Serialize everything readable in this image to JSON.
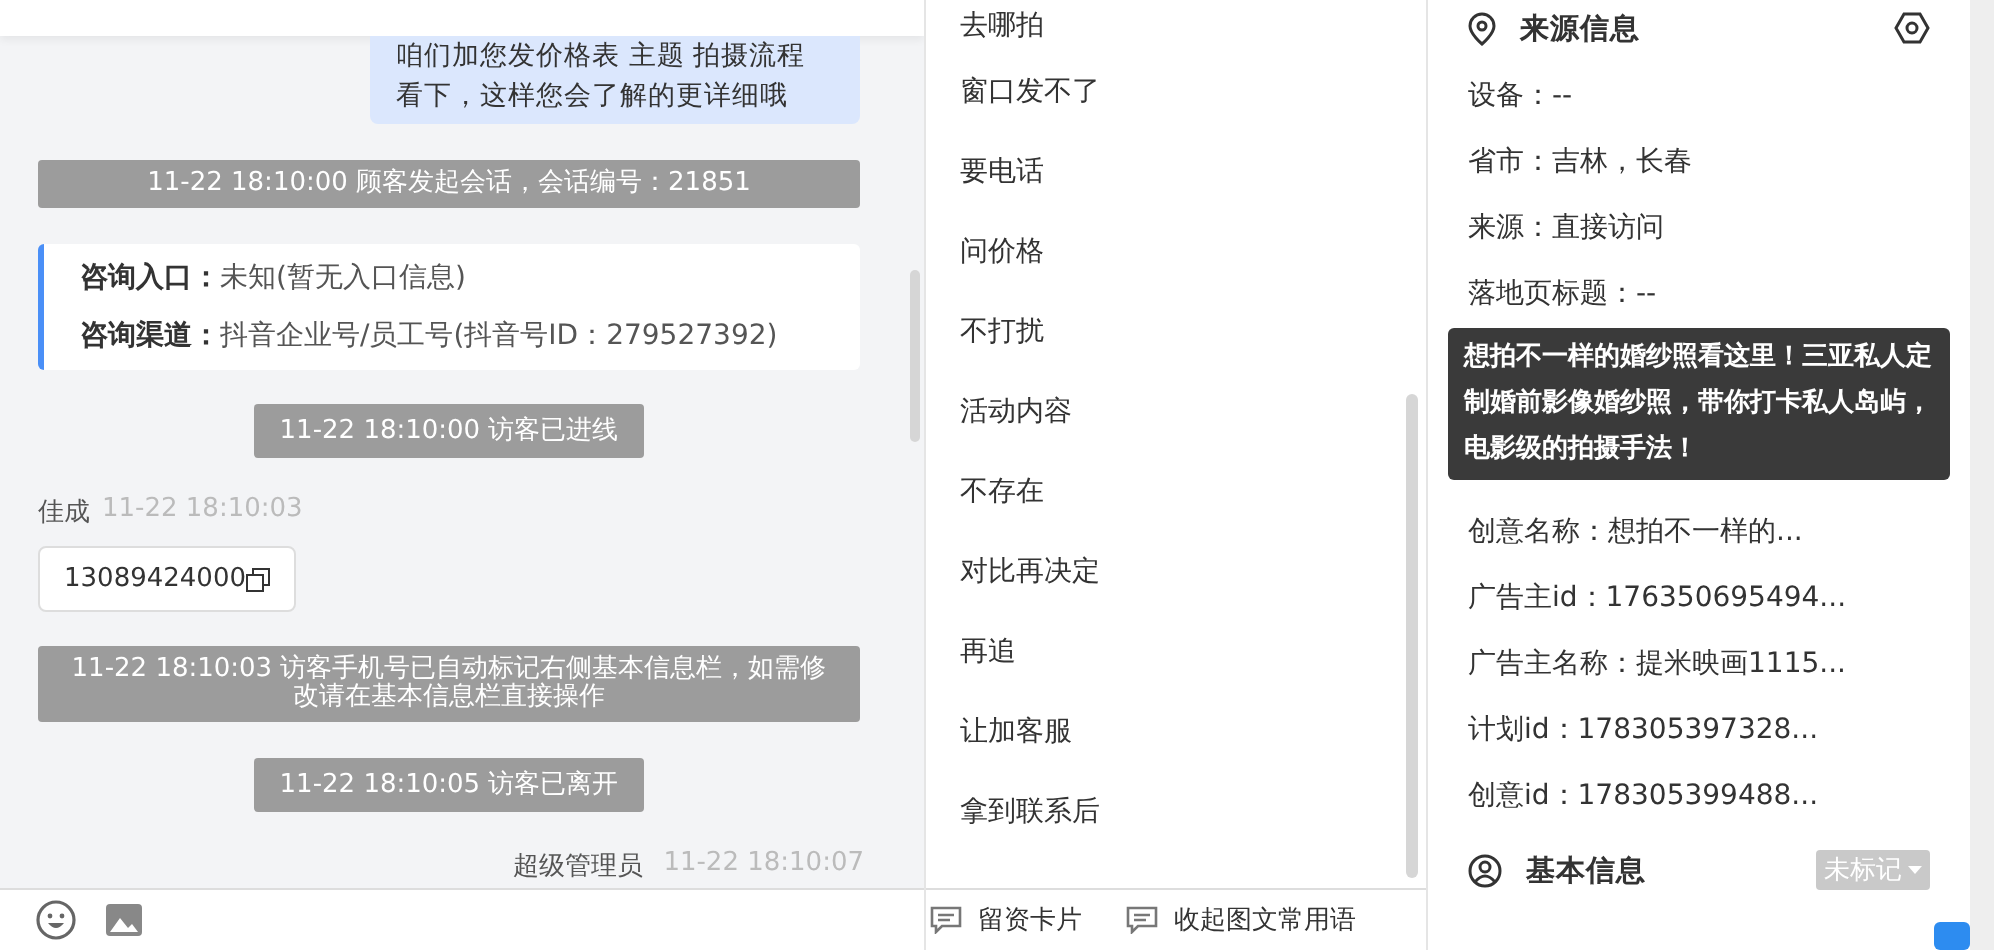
{
  "chat": {
    "messages": [
      {
        "kind": "outgoing",
        "text": "咱们加您发价格表 主题 拍摄流程看下，这样您会了解的更详细哦"
      },
      {
        "kind": "notice",
        "text": "11-22 18:10:00 顾客发起会话，会话编号：21851"
      },
      {
        "kind": "card",
        "fields": [
          {
            "label": "咨询入口：",
            "value": "未知(暂无入口信息)"
          },
          {
            "label": "咨询渠道：",
            "value": "抖音企业号/员工号(抖音号ID：279527392)"
          }
        ]
      },
      {
        "kind": "notice",
        "text": "11-22 18:10:00 访客已进线"
      },
      {
        "kind": "incoming",
        "sender": "佳成",
        "time": "11-22 18:10:03",
        "text": "13089424000"
      },
      {
        "kind": "notice",
        "text": "11-22 18:10:03 访客手机号已自动标记右侧基本信息栏，如需修改请在基本信息栏直接操作"
      },
      {
        "kind": "notice",
        "text": "11-22 18:10:05 访客已离开"
      },
      {
        "kind": "sender_line",
        "sender": "超级管理员",
        "time": "11-22 18:10:07"
      }
    ]
  },
  "phrases": {
    "items": [
      "去哪拍",
      "窗口发不了",
      "要电话",
      "问价格",
      "不打扰",
      "活动内容",
      "不存在",
      "对比再决定",
      "再追",
      "让加客服",
      "拿到联系后"
    ]
  },
  "toolbar": {
    "buttons": [
      "留资卡片",
      "收起图文常用语"
    ]
  },
  "source_info": {
    "title": "来源信息",
    "rows": [
      "设备：--",
      "省市：吉林，长春",
      "来源：直接访问",
      "落地页标题：--",
      "创意名称：想拍不一样的...",
      "广告主id：176350695494...",
      "广告主名称：提米映画1115...",
      "计划id：178305397328...",
      "创意id：178305399488..."
    ],
    "tooltip": "想拍不一样的婚纱照看这里！三亚私人定制婚前影像婚纱照，带你打卡私人岛屿，电影级的拍摄手法！"
  },
  "basic_info": {
    "title": "基本信息",
    "tag": "未标记"
  }
}
